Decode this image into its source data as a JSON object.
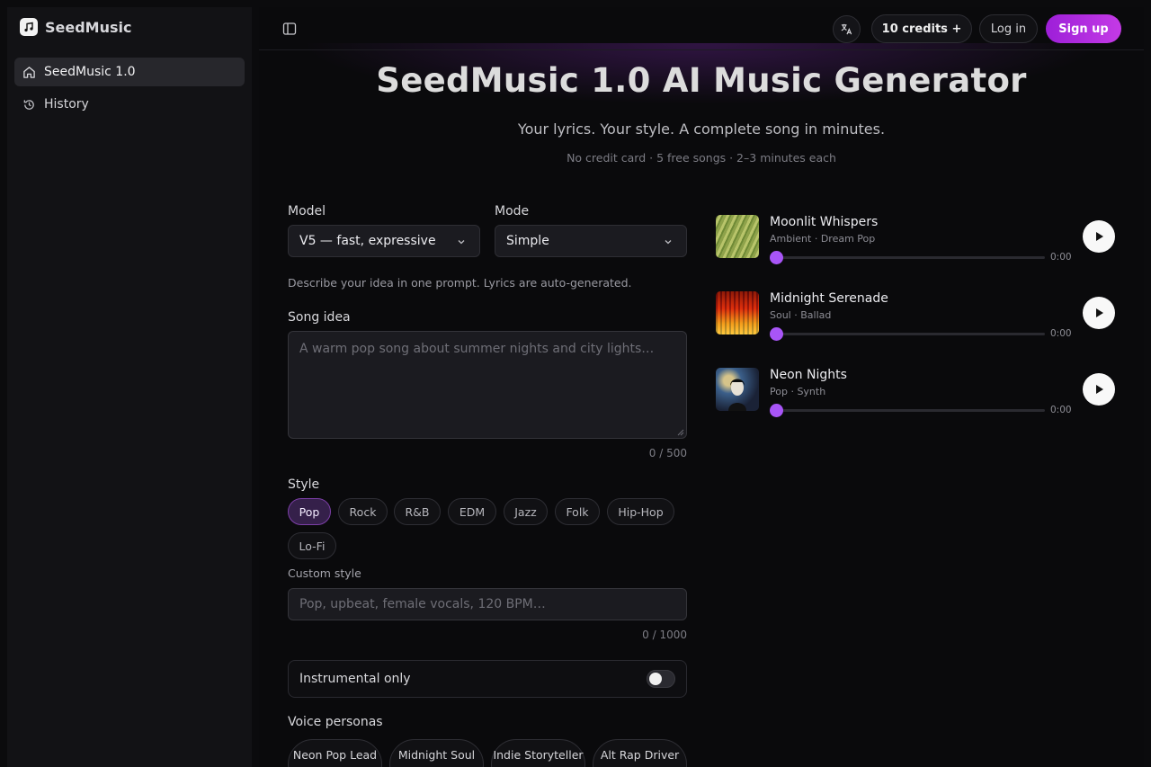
{
  "sidebar": {
    "brand": "SeedMusic",
    "items": [
      {
        "label": "SeedMusic 1.0",
        "icon": "home-icon"
      },
      {
        "label": "History",
        "icon": "history-icon"
      }
    ]
  },
  "topbar": {
    "credits_label": "10 credits +",
    "login_label": "Log in",
    "signup_label": "Sign up"
  },
  "hero": {
    "title": "SeedMusic 1.0 AI Music Generator",
    "subtitle": "Your lyrics. Your style. A complete song in minutes.",
    "note": "No credit card · 5 free songs · 2–3 minutes each"
  },
  "form": {
    "model_label": "Model",
    "model_value": "V5 — fast, expressive",
    "mode_label": "Mode",
    "mode_value": "Simple",
    "hint": "Describe your idea in one prompt. Lyrics are auto-generated.",
    "song_idea_label": "Song idea",
    "song_idea_placeholder": "A warm pop song about summer nights and city lights…",
    "song_idea_counter": "0 / 500",
    "style_label": "Style",
    "styles": [
      "Pop",
      "Rock",
      "R&B",
      "EDM",
      "Jazz",
      "Folk",
      "Hip-Hop",
      "Lo-Fi"
    ],
    "selected_style": "Pop",
    "custom_style_label": "Custom style",
    "custom_style_placeholder": "Pop, upbeat, female vocals, 120 BPM…",
    "custom_style_counter": "0 / 1000",
    "instrumental_label": "Instrumental only",
    "instrumental_on": false,
    "voice_personas_label": "Voice personas",
    "personas": [
      "Neon Pop Lead",
      "Midnight Soul",
      "Indie Storyteller",
      "Alt Rap Driver"
    ]
  },
  "tracks": [
    {
      "title": "Moonlit Whispers",
      "genre": "Ambient · Dream Pop",
      "time": "0:00",
      "progress": 0
    },
    {
      "title": "Midnight Serenade",
      "genre": "Soul · Ballad",
      "time": "0:00",
      "progress": 0
    },
    {
      "title": "Neon Nights",
      "genre": "Pop · Synth",
      "time": "0:00",
      "progress": 0
    }
  ],
  "colors": {
    "accent": "#a855f7",
    "signup_gradient_start": "#9d1fd8",
    "signup_gradient_end": "#c43ae6",
    "chip_active_bg": "#35204a"
  }
}
